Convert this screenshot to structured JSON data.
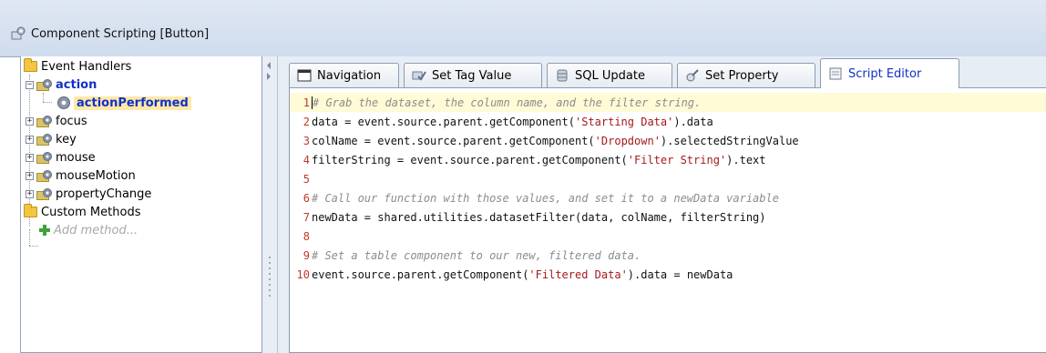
{
  "window": {
    "title": "Component Scripting [Button]"
  },
  "tree": {
    "root_label": "Event Handlers",
    "action": {
      "label": "action",
      "child": "actionPerformed"
    },
    "items": [
      "focus",
      "key",
      "mouse",
      "mouseMotion",
      "propertyChange"
    ],
    "custom_methods": "Custom Methods",
    "add_method": "Add method..."
  },
  "tabs": [
    {
      "label": "Navigation",
      "icon": "window-icon"
    },
    {
      "label": "Set Tag Value",
      "icon": "tag-check-icon"
    },
    {
      "label": "SQL Update",
      "icon": "database-icon"
    },
    {
      "label": "Set Property",
      "icon": "property-icon"
    },
    {
      "label": "Script Editor",
      "icon": "script-icon",
      "active": true
    }
  ],
  "code_lines": [
    {
      "n": "1",
      "text": "# Grab the dataset, the column name, and the filter string."
    },
    {
      "n": "2",
      "text": "data = event.source.parent.getComponent('Starting Data').data"
    },
    {
      "n": "3",
      "text": "colName = event.source.parent.getComponent('Dropdown').selectedStringValue"
    },
    {
      "n": "4",
      "text": "filterString = event.source.parent.getComponent('Filter String').text"
    },
    {
      "n": "5",
      "text": ""
    },
    {
      "n": "6",
      "text": "# Call our function with those values, and set it to a newData variable"
    },
    {
      "n": "7",
      "text": "newData = shared.utilities.datasetFilter(data, colName, filterString)"
    },
    {
      "n": "8",
      "text": ""
    },
    {
      "n": "9",
      "text": "# Set a table component to our new, filtered data."
    },
    {
      "n": "10",
      "text": "event.source.parent.getComponent('Filtered Data').data = newData"
    }
  ],
  "colors": {
    "accent": "#1030c8",
    "line_numbers": "#c0392b",
    "string": "#a41a1a",
    "comment": "#8c8c8c",
    "highlight_line": "#fffbd6"
  }
}
